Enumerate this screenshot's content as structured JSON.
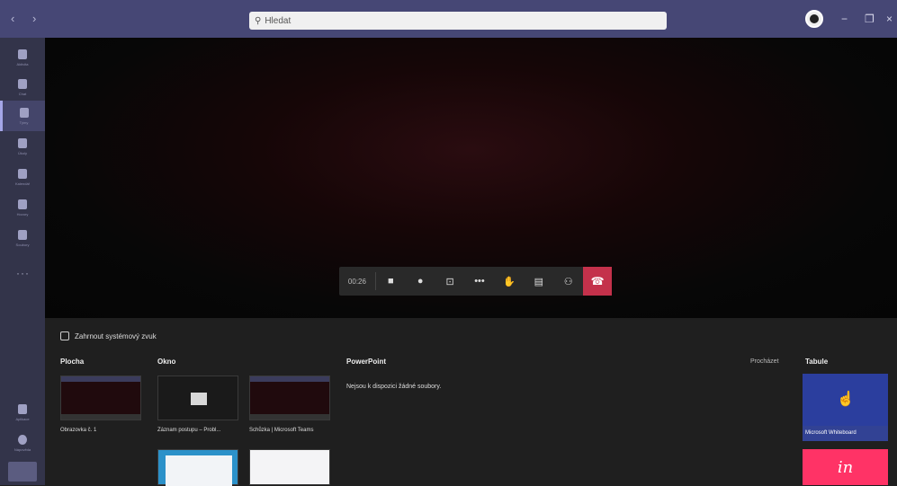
{
  "titlebar": {
    "nav": "‹ ›",
    "search_placeholder": "Hledat",
    "window_controls": [
      "−",
      "❐",
      "×"
    ]
  },
  "rail": {
    "items": [
      {
        "icon": "bell-icon",
        "label": "Aktivita"
      },
      {
        "icon": "chat-icon",
        "label": "Chat"
      },
      {
        "icon": "teams-icon",
        "label": "Týmy"
      },
      {
        "icon": "assignments-icon",
        "label": "Úkoly"
      },
      {
        "icon": "calendar-icon",
        "label": "Kalendář"
      },
      {
        "icon": "phone-icon",
        "label": "Hovory"
      },
      {
        "icon": "files-icon",
        "label": "Soubory"
      }
    ],
    "more": "···",
    "apps_label": "Aplikace",
    "help_label": "Nápověda"
  },
  "call": {
    "timer": "00:26",
    "controls": [
      "camera-icon",
      "mic-icon",
      "share-icon",
      "more-icon",
      "raise-hand-icon",
      "chat-icon",
      "participants-icon",
      "hangup-icon"
    ]
  },
  "tray": {
    "system_audio_label": "Zahrnout systémový zvuk",
    "sections": {
      "desktop": "Plocha",
      "window": "Okno",
      "powerpoint": "PowerPoint",
      "whiteboard": "Tabule"
    },
    "desktop_thumb_label": "Obrazovka č. 1",
    "window_thumbs": [
      "Záznam postupu – Probl...",
      "Schůzka | Microsoft Teams"
    ],
    "powerpoint_empty": "Nejsou k dispozici žádné soubory.",
    "browse_label": "Procházet",
    "whiteboard_label": "Microsoft Whiteboard",
    "invision_label": "in"
  }
}
